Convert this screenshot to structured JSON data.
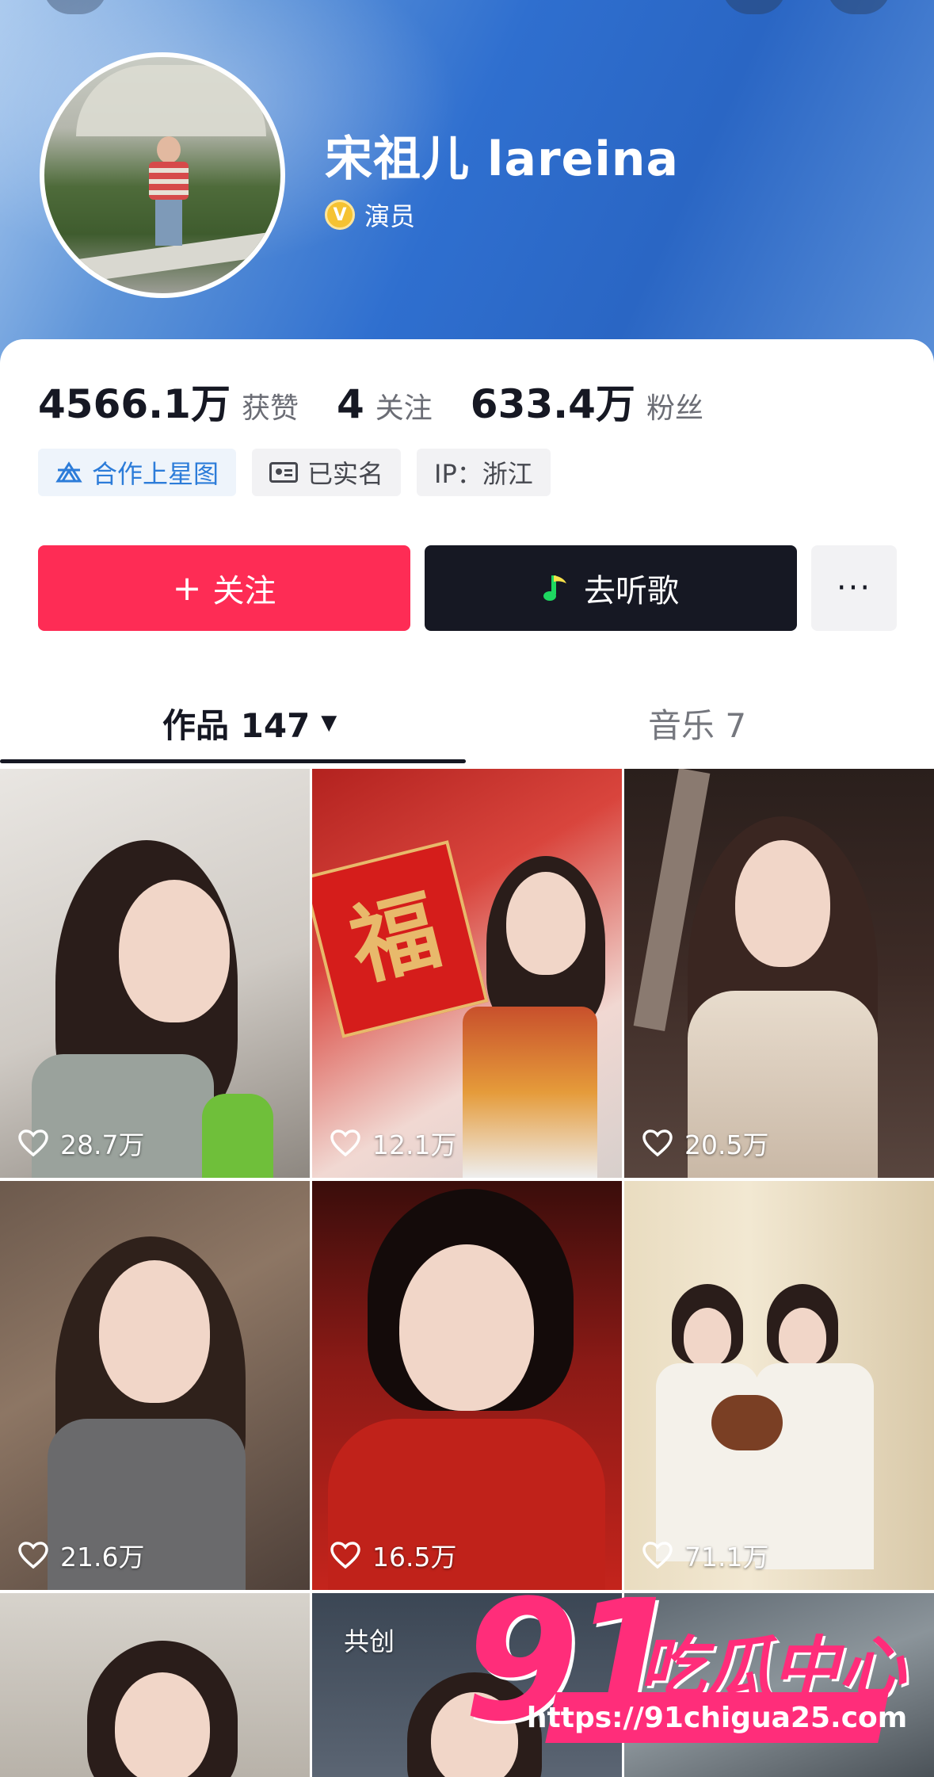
{
  "profile": {
    "name": "宋祖儿 lareina",
    "verified_badge": "V",
    "role": "演员"
  },
  "stats": [
    {
      "value": "4566.1万",
      "label": "获赞"
    },
    {
      "value": "4",
      "label": "关注"
    },
    {
      "value": "633.4万",
      "label": "粉丝"
    }
  ],
  "tags": {
    "star_map": "合作上星图",
    "real_name": "已实名",
    "ip": "IP：浙江"
  },
  "actions": {
    "follow_icon": "+",
    "follow": "关注",
    "listen": "去听歌",
    "more": "···"
  },
  "tabs": {
    "works_label": "作品 147",
    "works_caret": "▼",
    "music_label": "音乐 7"
  },
  "videos": [
    {
      "likes": "28.7万"
    },
    {
      "likes": "12.1万"
    },
    {
      "likes": "20.5万"
    },
    {
      "likes": "21.6万"
    },
    {
      "likes": "16.5万"
    },
    {
      "likes": "71.1万"
    },
    {
      "likes": ""
    },
    {
      "likes": "",
      "badge": "共创"
    },
    {
      "likes": ""
    }
  ],
  "thumb_text": {
    "fu": "福"
  },
  "watermark": {
    "number": "91",
    "title": "吃瓜中心",
    "url": "https://91chigua25.com"
  },
  "colors": {
    "follow": "#fe2c55",
    "listen": "#161823",
    "star_tag": "#2c7cd9",
    "watermark": "#ff2d7a"
  },
  "icons": {
    "verified": "v-badge-icon",
    "star_map": "star-map-icon",
    "id_card": "id-card-icon",
    "music_note": "music-note-icon",
    "heart": "heart-icon",
    "caret": "caret-down-icon"
  }
}
